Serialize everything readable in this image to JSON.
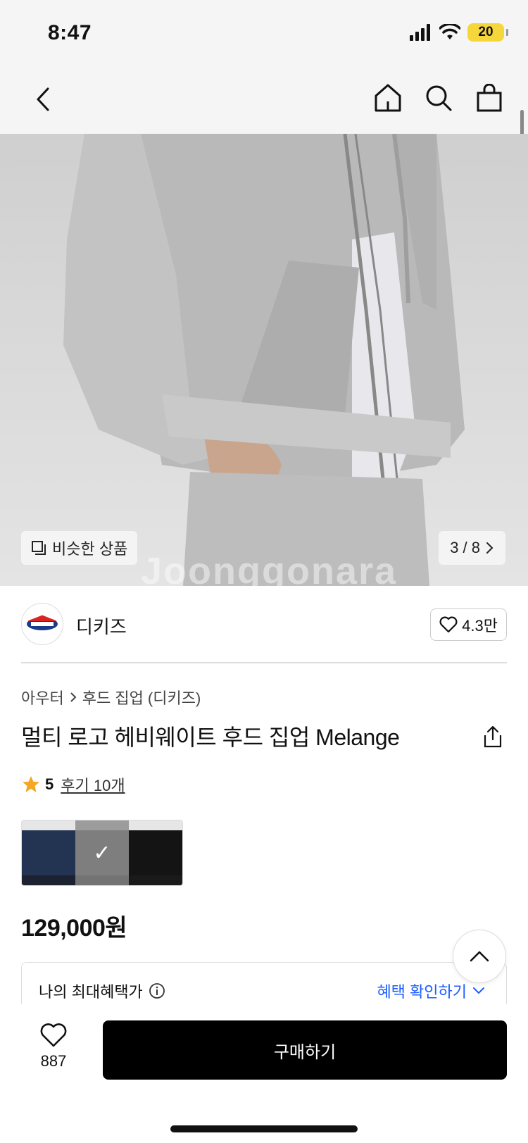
{
  "status_bar": {
    "time": "8:47",
    "battery": "20"
  },
  "product_image": {
    "similar_label": "비슷한 상품",
    "pager": "3 / 8",
    "watermark": "Joonggonara"
  },
  "brand": {
    "name": "디키즈",
    "likes": "4.3만"
  },
  "breadcrumb": {
    "level1": "아우터",
    "level2": "후드 집업 (디키즈)"
  },
  "product": {
    "title": "멀티 로고 헤비웨이트 후드 집업 Melange",
    "rating": "5",
    "reviews": "후기 10개",
    "price": "129,000원"
  },
  "color_swatches": [
    {
      "color": "#233352",
      "selected": false
    },
    {
      "color": "#a8a8a8",
      "selected": true
    },
    {
      "color": "#141414",
      "selected": false
    }
  ],
  "benefit": {
    "label": "나의 최대혜택가",
    "link": "혜택 확인하기"
  },
  "bottom_bar": {
    "wish_count": "887",
    "buy_label": "구매하기"
  },
  "colors": {
    "accent_link": "#1a5cff",
    "star": "#f5a623",
    "buy_button": "#000000"
  }
}
